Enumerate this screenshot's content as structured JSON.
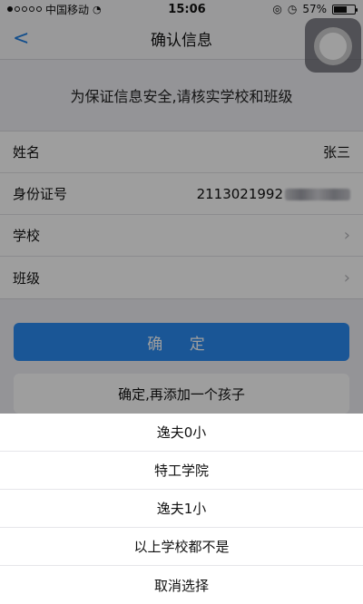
{
  "status_bar": {
    "carrier": "中国移动",
    "time": "15:06",
    "battery": "57%"
  },
  "nav": {
    "back_glyph": "<",
    "title": "确认信息"
  },
  "notice": "为保证信息安全,请核实学校和班级",
  "form": {
    "name_label": "姓名",
    "name_value": "张三",
    "id_label": "身份证号",
    "id_value": "2113021992",
    "school_label": "学校",
    "class_label": "班级"
  },
  "buttons": {
    "confirm": "确 定",
    "confirm_add": "确定,再添加一个孩子"
  },
  "action_sheet": {
    "options": [
      "逸夫0小",
      "特工学院",
      "逸夫1小",
      "以上学校都不是"
    ],
    "cancel": "取消选择"
  },
  "icons": {
    "back": "back-arrow-icon",
    "chevron": "chevron-right-icon",
    "assistive": "assistive-touch-icon"
  },
  "colors": {
    "accent": "#2b8cf3",
    "overlay": "rgba(0,0,0,0.38)"
  }
}
